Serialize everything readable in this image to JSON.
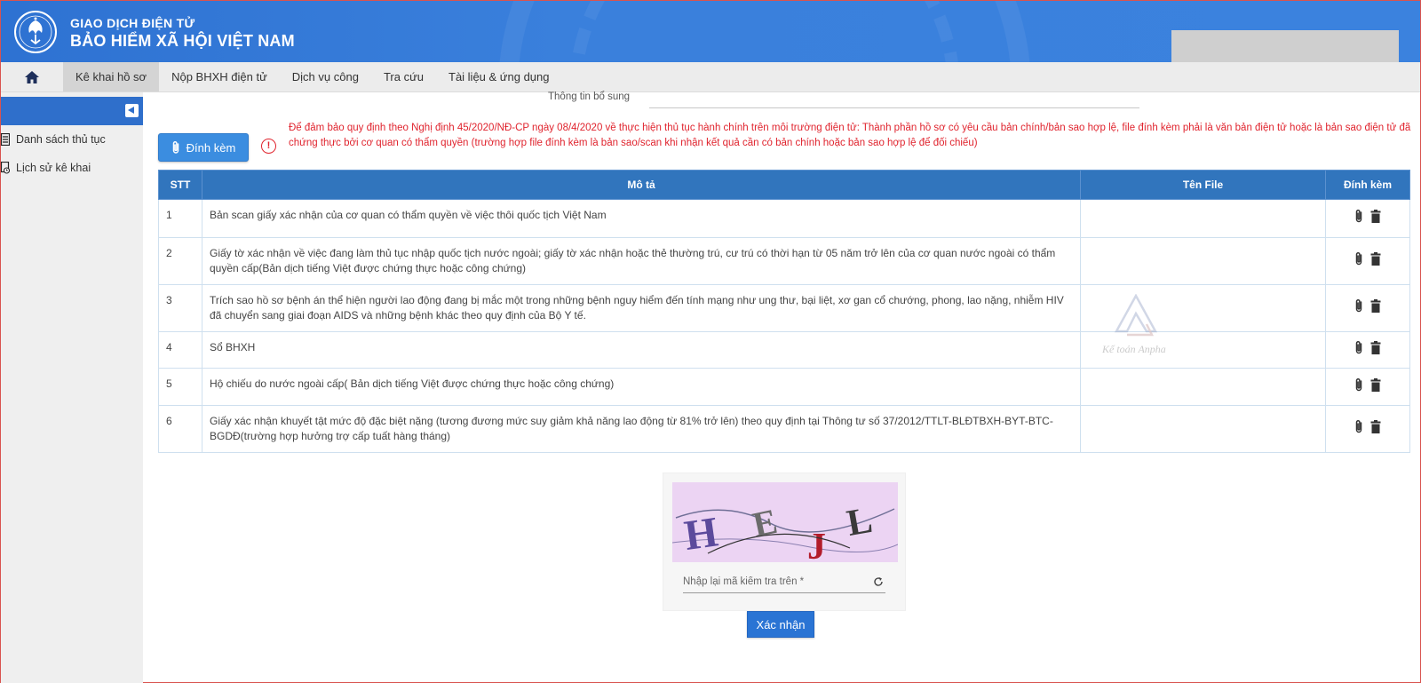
{
  "header": {
    "brand_line1": "GIAO DỊCH ĐIỆN TỬ",
    "brand_line2": "BẢO HIỂM XÃ HỘI VIỆT NAM",
    "logo_icon": "bhxh-logo-icon"
  },
  "nav": {
    "home_icon": "home-icon",
    "items": [
      {
        "label": "Kê khai hồ sơ",
        "active": true
      },
      {
        "label": "Nộp BHXH điện tử",
        "active": false
      },
      {
        "label": "Dịch vụ công",
        "active": false
      },
      {
        "label": "Tra cứu",
        "active": false
      },
      {
        "label": "Tài liệu & ứng dụng",
        "active": false
      }
    ]
  },
  "sidebar": {
    "items": [
      {
        "label": "Danh sách thủ tục",
        "icon": "document-list-icon"
      },
      {
        "label": "Lịch sử kê khai",
        "icon": "history-icon"
      }
    ]
  },
  "form": {
    "extra_info_label": "Thông tin bổ sung",
    "attach_button": "Đính kèm",
    "warning": "Để đảm bảo quy định theo Nghị định 45/2020/NĐ-CP ngày 08/4/2020 về thực hiện thủ tục hành chính trên môi trường điện tử: Thành phần hồ sơ có yêu cầu bản chính/bản sao hợp lệ, file đính kèm phải là văn bản điện tử hoặc là bản sao điện tử đã chứng thực bởi cơ quan có thẩm quyền (trường hợp file đính kèm là bản sao/scan khi nhận kết quả cần có bản chính hoặc bản sao hợp lệ để đối chiếu)"
  },
  "table": {
    "headers": {
      "stt": "STT",
      "desc": "Mô tả",
      "file": "Tên File",
      "attach": "Đính kèm"
    },
    "rows": [
      {
        "stt": "1",
        "desc": "Bản scan giấy xác nhận của cơ quan có thẩm quyền về việc thôi quốc tịch Việt Nam",
        "file": ""
      },
      {
        "stt": "2",
        "desc": "Giấy tờ xác nhận về việc đang làm thủ tục nhập quốc tịch nước ngoài; giấy tờ xác nhận hoặc thẻ thường trú, cư trú có thời hạn từ 05 năm trở lên của cơ quan nước ngoài có thẩm quyền cấp(Bản dịch tiếng Việt được chứng thực hoặc công chứng)",
        "file": ""
      },
      {
        "stt": "3",
        "desc": "Trích sao hồ sơ bệnh án thể hiện người lao động đang bị mắc một trong những bệnh nguy hiểm đến tính mạng như ung thư, bại liệt, xơ gan cổ chướng, phong, lao nặng, nhiễm HIV đã chuyển sang giai đoạn AIDS và những bệnh khác theo quy định của Bộ Y tế.",
        "file": ""
      },
      {
        "stt": "4",
        "desc": "Sổ BHXH",
        "file": ""
      },
      {
        "stt": "5",
        "desc": "Hộ chiếu do nước ngoài cấp( Bản dịch tiếng Việt được chứng thực hoặc công chứng)",
        "file": ""
      },
      {
        "stt": "6",
        "desc": "Giấy xác nhận khuyết tật mức độ đặc biệt nặng (tương đương mức suy giảm khả năng lao động từ 81% trở lên) theo quy định tại Thông tư số 37/2012/TTLT-BLĐTBXH-BYT-BTC-BGDĐ(trường hợp hưởng trợ cấp tuất hàng tháng)",
        "file": ""
      }
    ]
  },
  "watermark": {
    "text": "Kế toán Anpha"
  },
  "captcha": {
    "letters": [
      "H",
      "E",
      "J",
      "L"
    ],
    "placeholder": "Nhập lại mã kiểm tra trên *",
    "value": ""
  },
  "confirm_button": "Xác nhận",
  "colors": {
    "header_blue": "#3a80dc",
    "table_header": "#3175bd",
    "warning_red": "#e0242e",
    "button_blue": "#2a74d4"
  }
}
